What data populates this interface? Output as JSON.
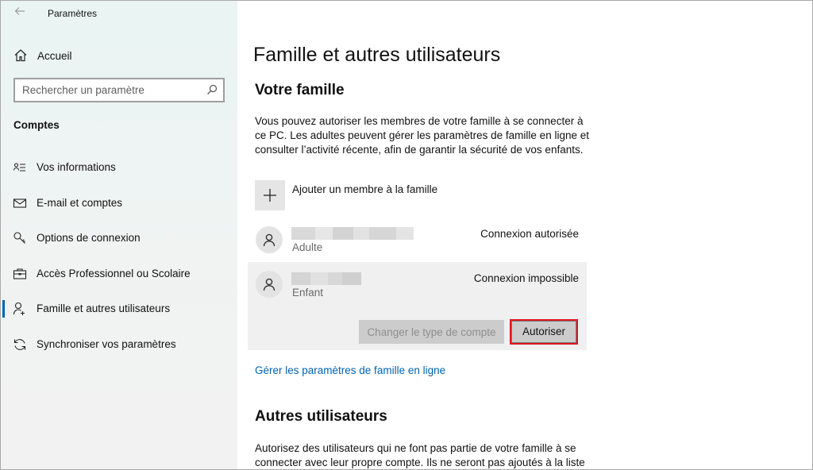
{
  "app": {
    "title": "Paramètres",
    "back_icon": "arrow-left-icon",
    "caption_buttons": {
      "minimize": "–",
      "maximize": "☐",
      "close": "✕"
    }
  },
  "sidebar": {
    "home_label": "Accueil",
    "search_placeholder": "Rechercher un paramètre",
    "section_title": "Comptes",
    "items": [
      {
        "label": "Vos informations",
        "icon": "user-card-icon",
        "active": false
      },
      {
        "label": "E-mail et comptes",
        "icon": "mail-icon",
        "active": false
      },
      {
        "label": "Options de connexion",
        "icon": "key-icon",
        "active": false
      },
      {
        "label": "Accès Professionnel ou Scolaire",
        "icon": "briefcase-icon",
        "active": false
      },
      {
        "label": "Famille et autres utilisateurs",
        "icon": "add-person-icon",
        "active": true
      },
      {
        "label": "Synchroniser vos paramètres",
        "icon": "sync-icon",
        "active": false
      }
    ]
  },
  "main": {
    "page_title": "Famille et autres utilisateurs",
    "family": {
      "heading": "Votre famille",
      "description": "Vous pouvez autoriser les membres de votre famille à se connecter à ce PC. Les adultes peuvent gérer les paramètres de famille en ligne et consulter l’activité récente, afin de garantir la sécurité de vos enfants.",
      "add_member_label": "Ajouter un membre à la famille",
      "members": [
        {
          "role": "Adulte",
          "status": "Connexion autorisée"
        },
        {
          "role": "Enfant",
          "status": "Connexion impossible"
        }
      ],
      "change_type_button": "Changer le type de compte",
      "allow_button": "Autoriser",
      "manage_link": "Gérer les paramètres de famille en ligne"
    },
    "others": {
      "heading": "Autres utilisateurs",
      "description": "Autorisez des utilisateurs qui ne font pas partie de votre famille à se connecter avec leur propre compte. Ils ne seront pas ajoutés à la liste"
    }
  },
  "colors": {
    "accent": "#0063b1",
    "highlight_border": "#e2141c",
    "selected_row": "#f0f0f0"
  }
}
